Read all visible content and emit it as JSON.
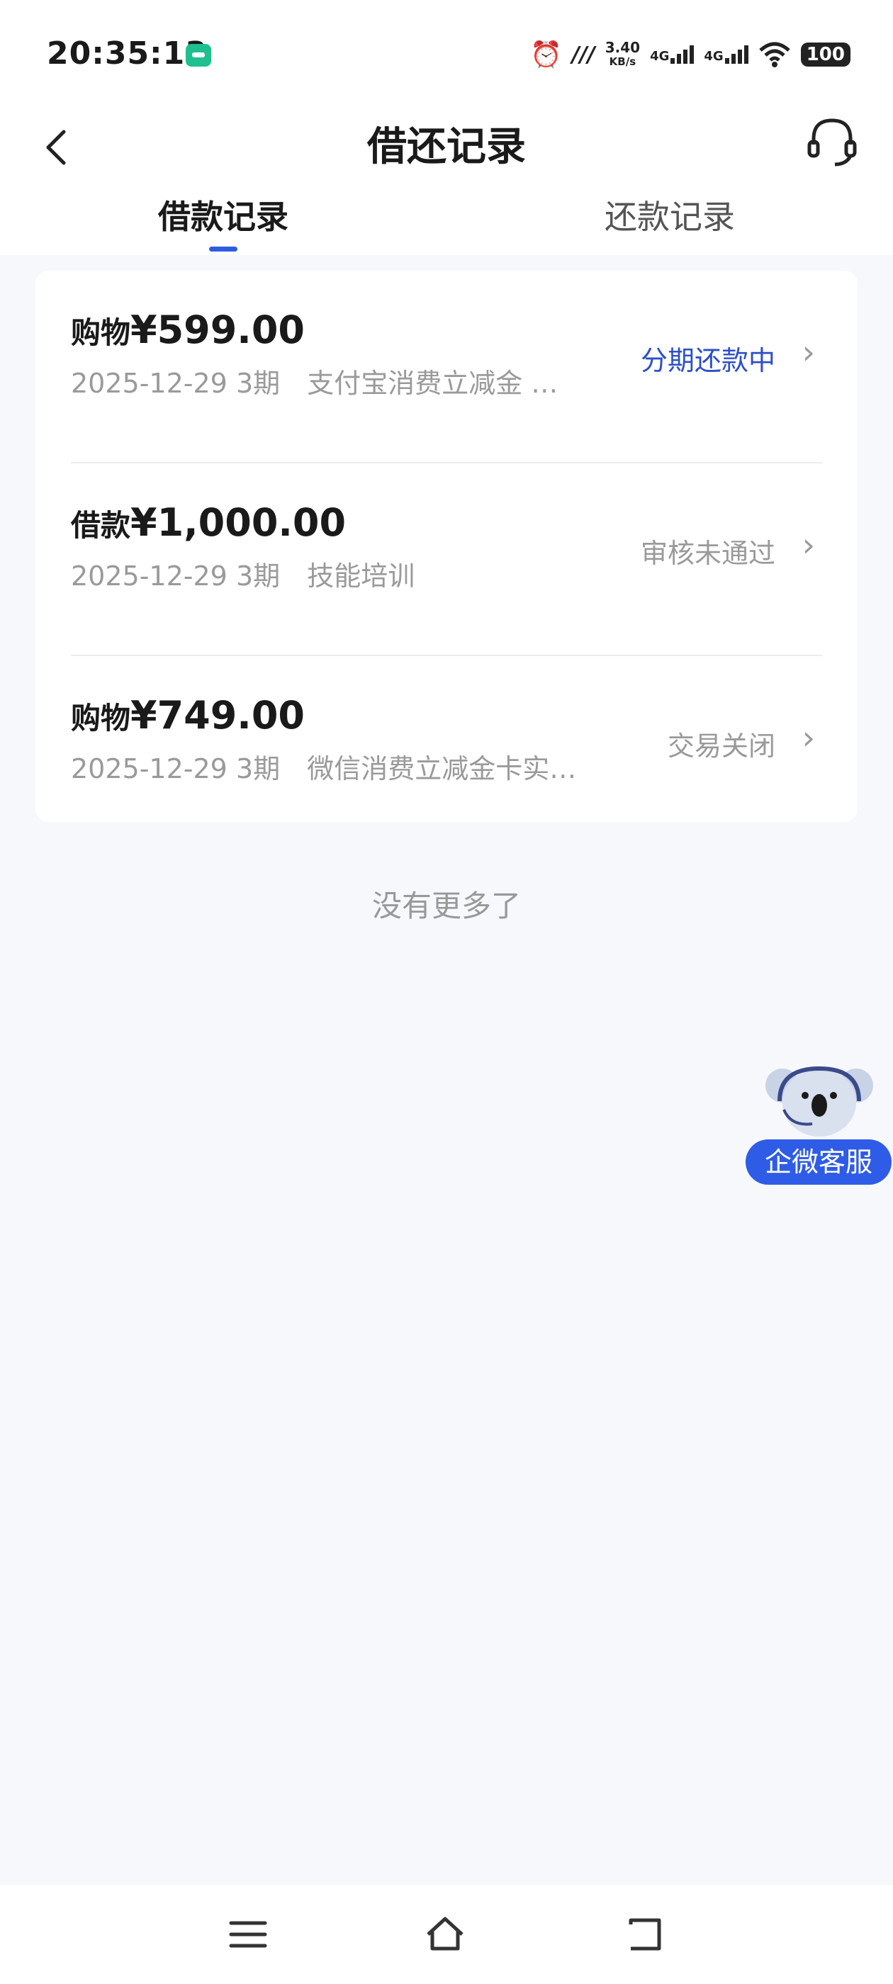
{
  "status_bar": {
    "time": "20:35:13",
    "speed_value": "3.40",
    "speed_unit": "KB/s",
    "net1": "4G",
    "net2": "4G",
    "battery": "100"
  },
  "header": {
    "title": "借还记录",
    "tabs": [
      {
        "label": "借款记录",
        "active": true
      },
      {
        "label": "还款记录",
        "active": false
      }
    ]
  },
  "records": [
    {
      "type": "购物",
      "amount": "¥599.00",
      "date": "2025-12-29",
      "term": "3期",
      "desc": "支付宝消费立减金 …",
      "status": "分期还款中",
      "status_active": true
    },
    {
      "type": "借款",
      "amount": "¥1,000.00",
      "date": "2025-12-29",
      "term": "3期",
      "desc": "技能培训",
      "status": "审核未通过",
      "status_active": false
    },
    {
      "type": "购物",
      "amount": "¥749.00",
      "date": "2025-12-29",
      "term": "3期",
      "desc": "微信消费立减金卡实…",
      "status": "交易关闭",
      "status_active": false
    }
  ],
  "footer_note": "没有更多了",
  "floating_service": {
    "label": "企微客服"
  },
  "icons": {
    "back": "chevron-left-icon",
    "service": "headset-icon",
    "row_chevron": "chevron-right-icon",
    "nav": [
      "menu-icon",
      "home-icon",
      "back-icon"
    ]
  },
  "colors": {
    "accent": "#2e5ce0",
    "active_status": "#2d4fc7",
    "muted": "#9a9a9a",
    "background": "#f7f8fc"
  }
}
